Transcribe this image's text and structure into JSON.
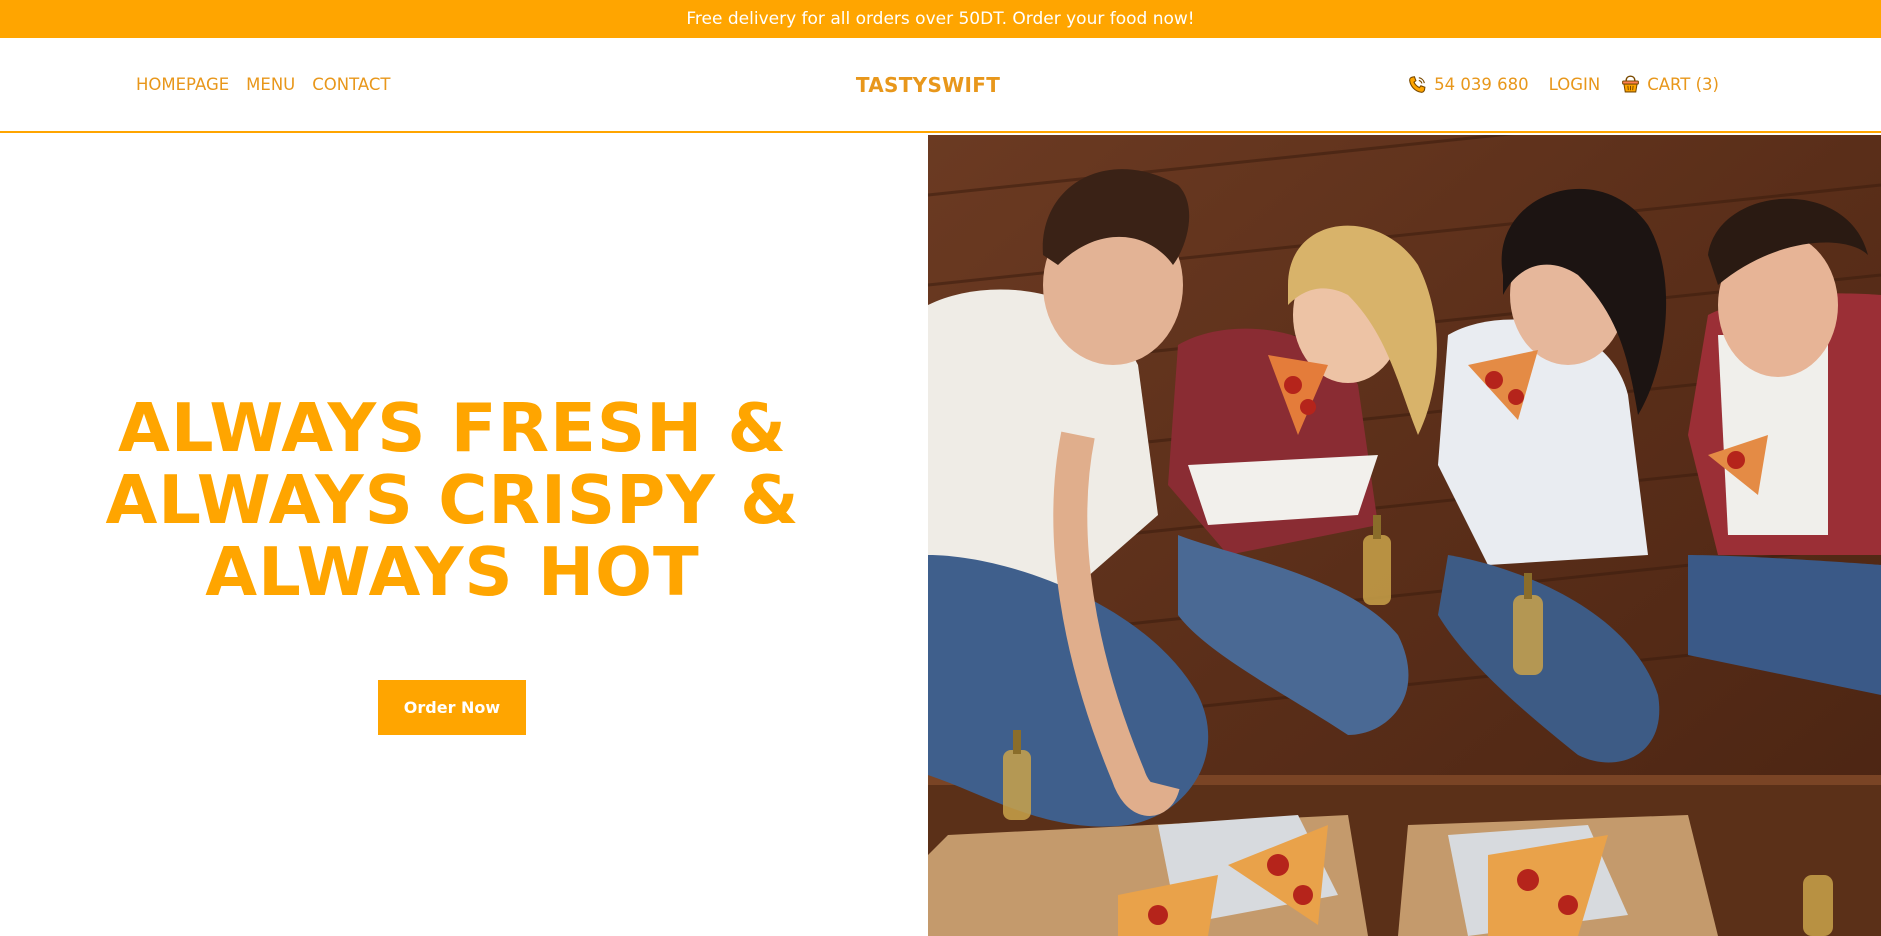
{
  "promo": {
    "text": "Free delivery for all orders over 50DT. Order your food now!"
  },
  "nav": {
    "links": [
      {
        "label": "HOMEPAGE"
      },
      {
        "label": "MENU"
      },
      {
        "label": "CONTACT"
      }
    ],
    "brand": "TASTYSWIFT",
    "phone": {
      "icon": "phone-icon",
      "label": "54 039 680"
    },
    "login": {
      "label": "LOGIN"
    },
    "cart": {
      "icon": "basket-icon",
      "label": "CART (3)"
    }
  },
  "hero": {
    "headline_lines": [
      "ALWAYS FRESH &",
      "ALWAYS CRISPY &",
      "ALWAYS HOT"
    ],
    "cta_label": "Order Now",
    "image": {
      "icon": "hero-photo-friends-eating-pizza"
    }
  },
  "colors": {
    "accent": "#ffa500",
    "link": "#e8971b",
    "background": "#ffffff"
  }
}
